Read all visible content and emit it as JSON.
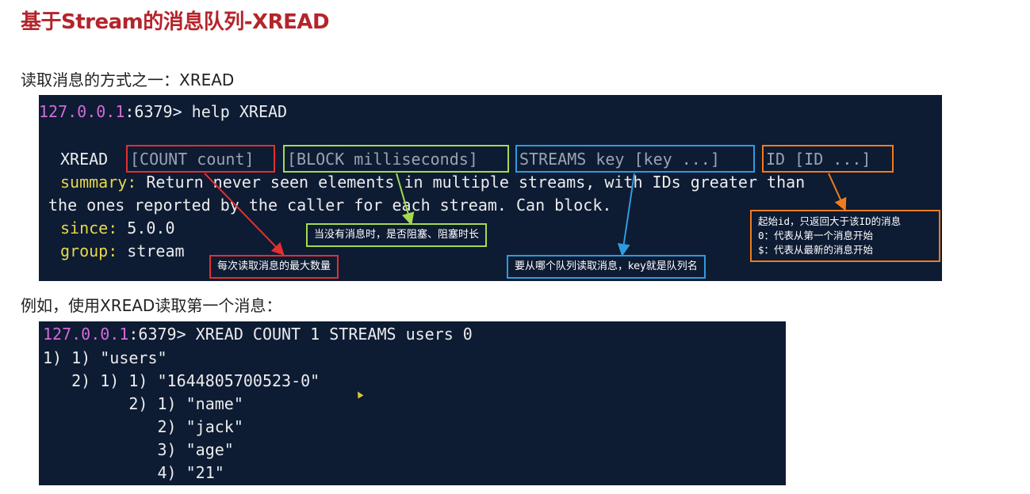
{
  "heading": "基于Stream的消息队列-XREAD",
  "intro": "读取消息的方式之一：XREAD",
  "example_intro": "例如，使用XREAD读取第一个消息：",
  "terminal1": {
    "prompt_host": "127.0.0.1",
    "prompt_rest": ":6379> help XREAD",
    "cmd": "XREAD",
    "opt_count": "[COUNT count]",
    "opt_block": "[BLOCK milliseconds]",
    "opt_streams": "STREAMS key [key ...]",
    "opt_id": "ID [ID ...]",
    "summary_key": "summary:",
    "summary_text": " Return never seen elements in multiple streams, with IDs greater than",
    "summary_line2": "the ones reported by the caller for each stream. Can block.",
    "since_key": "since:",
    "since_val": " 5.0.0",
    "group_key": "group:",
    "group_val": " stream"
  },
  "annotations": {
    "count": "每次读取消息的最大数量",
    "block": "当没有消息时，是否阻塞、阻塞时长",
    "streams": "要从哪个队列读取消息，key就是队列名",
    "id_line1": "起始id，只返回大于该ID的消息",
    "id_line2": "0：代表从第一个消息开始",
    "id_line3": "$：代表从最新的消息开始"
  },
  "terminal2": {
    "prompt_host": "127.0.0.1",
    "prompt_rest": ":6379> XREAD COUNT 1 STREAMS users 0",
    "lines": [
      "1) 1) \"users\"",
      "   2) 1) 1) \"1644805700523-0\"",
      "         2) 1) \"name\"",
      "            2) \"jack\"",
      "            3) \"age\"",
      "            4) \"21\""
    ]
  },
  "colors": {
    "red": "#e23030",
    "green": "#a6d94e",
    "blue": "#2f9bdc",
    "orange": "#f07c1e",
    "title": "#b5242b"
  }
}
